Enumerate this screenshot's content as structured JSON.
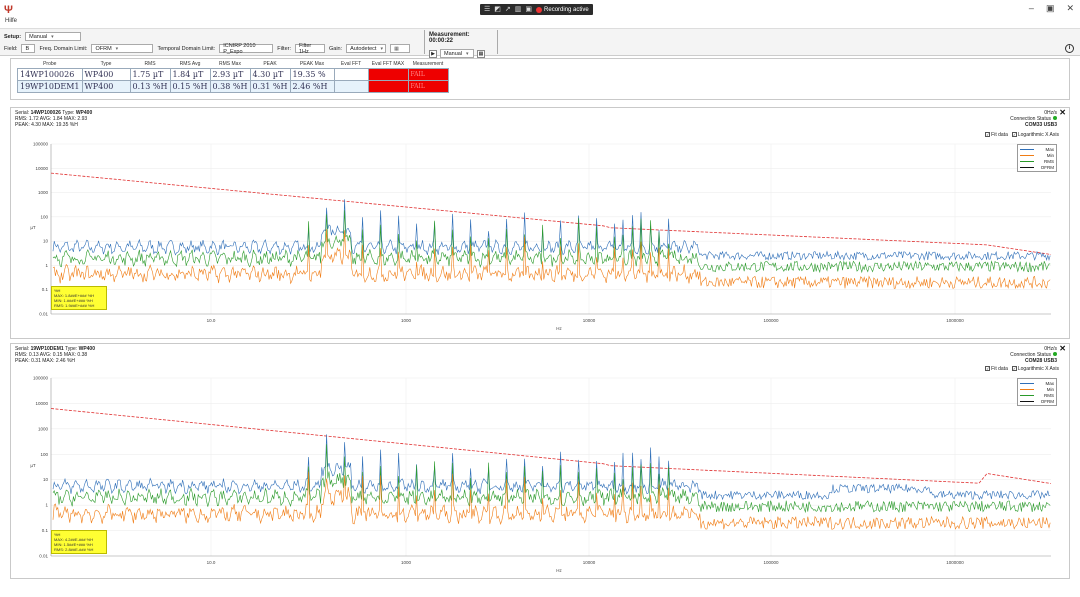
{
  "title_bar": {
    "logo_glyph": "Ψ",
    "help_label": "Hilfe",
    "recording_label": "Recording active",
    "win_minimize": "–",
    "win_restore": "▣",
    "win_close": "✕",
    "rec_tool_icons": [
      "☰",
      "◩",
      "↗",
      "▥",
      "▣"
    ]
  },
  "toolbar": {
    "setup_label": "Setup:",
    "setup_value": "Manual",
    "field_label": "Field:",
    "field_value": "B",
    "freq_domain_label": "Freq. Domain Limit:",
    "freq_domain_value": "OFRM",
    "temporal_domain_label": "Temporal Domain Limit:",
    "temporal_domain_value": "ICNIRP 2010 P_Expo",
    "filter_label": "Filter:",
    "filter_value": "Filter 1Hz",
    "gain_label": "Gain:",
    "gain_value": "Autodetect",
    "measurement_label": "Measurement:",
    "measurement_time": "00:00:22",
    "mode_value": "Manual",
    "info_glyph": "i"
  },
  "probe_table": {
    "columns": [
      "Probe",
      "Type",
      "RMS",
      "RMS Avg",
      "RMS Max",
      "PEAK",
      "PEAK Max",
      "Eval FFT",
      "Eval FFT MAX",
      "Measurement"
    ],
    "rows": [
      {
        "probe": "14WP100026",
        "type": "WP400",
        "rms": "1.75 µT",
        "rms_avg": "1.84 µT",
        "rms_max": "2.93 µT",
        "peak": "4.30 µT",
        "peak_max": "19.35 %",
        "eval_fft": "",
        "eval_fft_max": "",
        "measurement": "FAIL"
      },
      {
        "probe": "19WP10DEM1",
        "type": "WP400",
        "rms": "0.13 %H",
        "rms_avg": "0.15 %H",
        "rms_max": "0.38 %H",
        "peak": "0.31 %H",
        "peak_max": "2.46 %H",
        "eval_fft": "",
        "eval_fft_max": "",
        "measurement": "FAIL"
      }
    ]
  },
  "charts": [
    {
      "serial_label": "Serial:",
      "serial": "14WP100026",
      "type_label": "Type:",
      "type": "WP400",
      "rms_line": "RMS: 1.72  AVG: 1.84  MAX: 2.93",
      "peak_line": "PEAK: 4.30  MAX: 19.35  %H",
      "rate": "0Hz/s",
      "connection_label": "Connection Status",
      "com_port": "COM33 USB3",
      "fit_data_label": "Fit data",
      "log_x_label": "Logarithmic X Axis",
      "ylabel": "µT",
      "xlabel": "Hz",
      "legend": [
        "Max",
        "Min",
        "RMS",
        "OFRM"
      ],
      "yellow_box": [
        "%H",
        "MAX: 1.8##E+### %H",
        "MIN: 1.###E+### %H",
        "RMS: 1.9##E+### %H"
      ],
      "y_ticks": [
        "100000",
        "10000",
        "1000",
        "100",
        "10",
        "1",
        "0.1",
        "0.01"
      ],
      "x_ticks": [
        "10.0",
        "1000",
        "10000",
        "100000",
        "1000000"
      ]
    },
    {
      "serial_label": "Serial:",
      "serial": "19WP10DEM1",
      "type_label": "Type:",
      "type": "WP400",
      "rms_line": "RMS: 0.13  AVG: 0.15  MAX: 0.38",
      "peak_line": "PEAK: 0.31  MAX: 2.46  %H",
      "rate": "0Hz/s",
      "connection_label": "Connection Status",
      "com_port": "COM28 USB3",
      "fit_data_label": "Fit data",
      "log_x_label": "Logarithmic X Axis",
      "ylabel": "µT",
      "xlabel": "Hz",
      "legend": [
        "Max",
        "Min",
        "RMS",
        "OFRM"
      ],
      "yellow_box": [
        "%H",
        "MAX: 4.2##E-### %H",
        "MIN: 1.5##E+### %H",
        "RMS: 2.8##E-### %H"
      ],
      "y_ticks": [
        "100000",
        "10000",
        "1000",
        "100",
        "10",
        "1",
        "0.1",
        "0.01"
      ],
      "x_ticks": [
        "10.0",
        "1000",
        "10000",
        "100000",
        "1000000"
      ]
    }
  ],
  "colors": {
    "max": "#2f6fb8",
    "min": "#f07c14",
    "rms": "#2a9a2a",
    "limit": "#e03030",
    "fail": "#ee0000",
    "highlight": "#ffff33"
  }
}
